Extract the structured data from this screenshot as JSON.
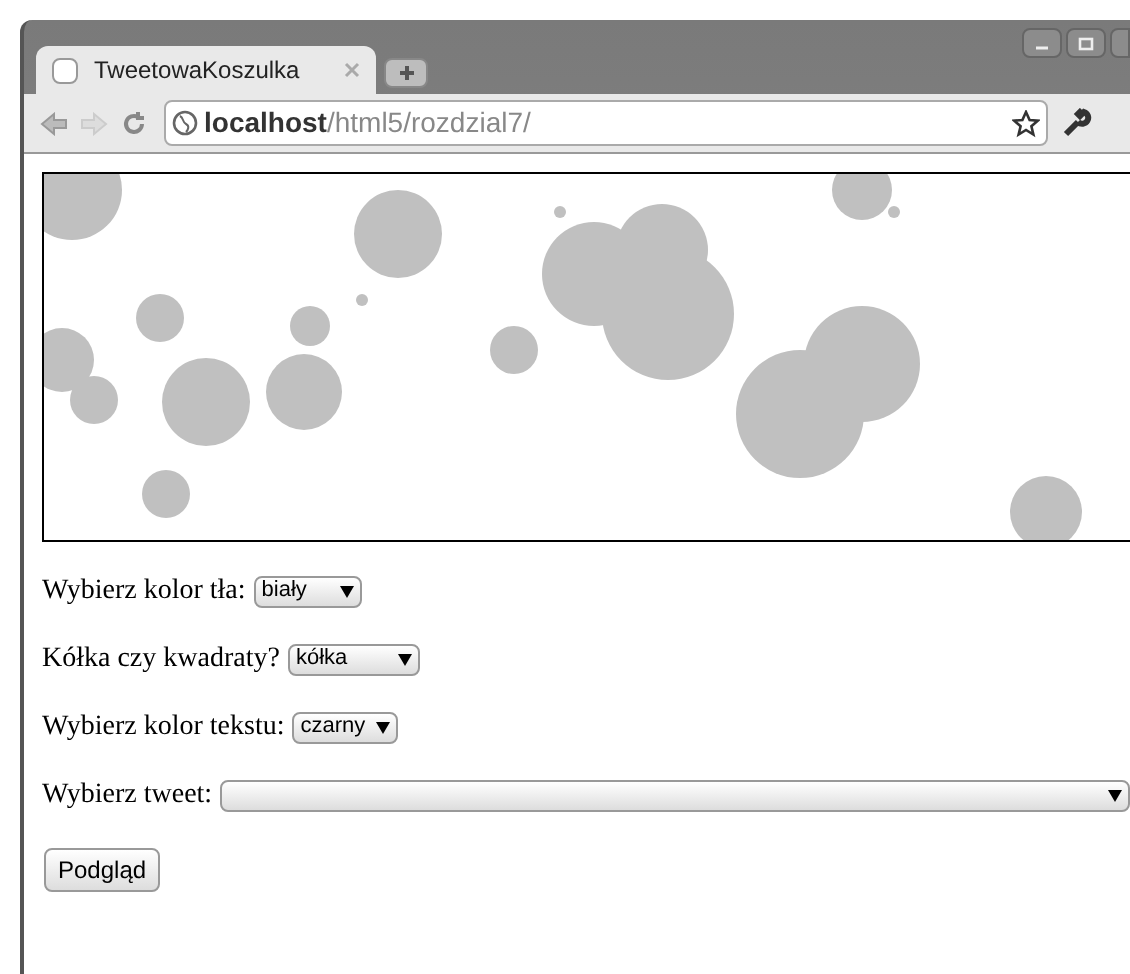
{
  "browser": {
    "tab_title": "TweetowaKoszulka",
    "url_host": "localhost",
    "url_path": "/html5/rozdzial7/"
  },
  "form": {
    "fields": [
      {
        "label": "Wybierz kolor tła:",
        "value": "biały"
      },
      {
        "label": "Kółka czy kwadraty?",
        "value": "kółka"
      },
      {
        "label": "Wybierz kolor tekstu:",
        "value": "czarny"
      },
      {
        "label": "Wybierz tweet:"
      }
    ],
    "button": "Podgląd"
  }
}
